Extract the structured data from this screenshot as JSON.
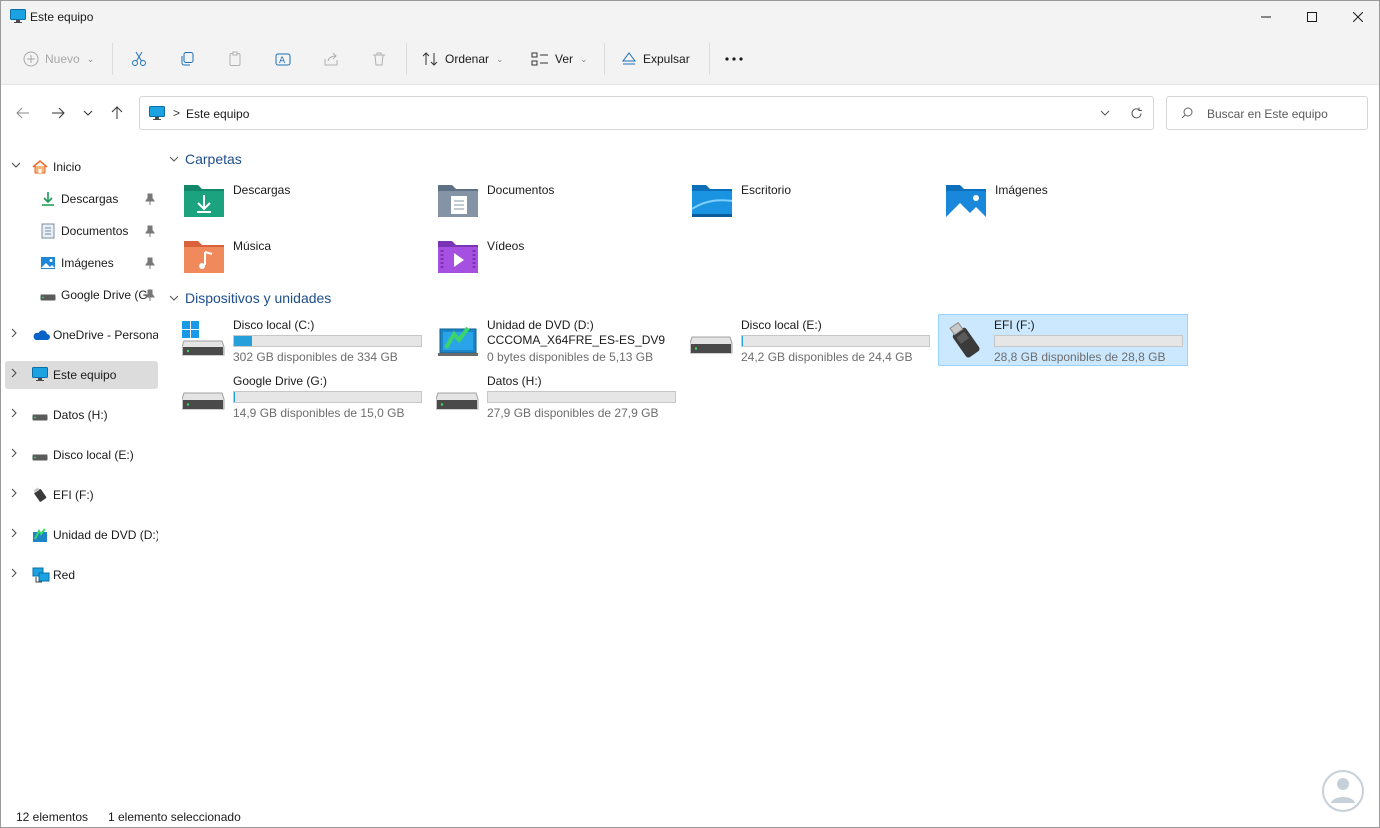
{
  "window": {
    "title": "Este equipo"
  },
  "toolbar": {
    "new_label": "Nuevo",
    "sort_label": "Ordenar",
    "view_label": "Ver",
    "eject_label": "Expulsar"
  },
  "address": {
    "path": "Este equipo",
    "separator": ">"
  },
  "search": {
    "placeholder": "Buscar en Este equipo"
  },
  "sidebar": {
    "items": [
      {
        "label": "Inicio"
      },
      {
        "label": "Descargas"
      },
      {
        "label": "Documentos"
      },
      {
        "label": "Imágenes"
      },
      {
        "label": "Google Drive (G"
      },
      {
        "label": "OneDrive - Personal"
      },
      {
        "label": "Este equipo"
      },
      {
        "label": "Datos (H:)"
      },
      {
        "label": "Disco local (E:)"
      },
      {
        "label": "EFI (F:)"
      },
      {
        "label": "Unidad de DVD (D:)"
      },
      {
        "label": "Red"
      }
    ]
  },
  "sections": {
    "folders": "Carpetas",
    "devices": "Dispositivos y unidades"
  },
  "folders": [
    {
      "name": "Descargas"
    },
    {
      "name": "Documentos"
    },
    {
      "name": "Escritorio"
    },
    {
      "name": "Imágenes"
    },
    {
      "name": "Música"
    },
    {
      "name": "Vídeos"
    }
  ],
  "drives": [
    {
      "name": "Disco local (C:)",
      "free_text": "302 GB disponibles de 334 GB",
      "used_fraction": 0.096
    },
    {
      "name": "Unidad de DVD (D:)",
      "name2": "CCCOMA_X64FRE_ES-ES_DV9",
      "free_text": "0 bytes disponibles de 5,13 GB"
    },
    {
      "name": "Disco local (E:)",
      "free_text": "24,2 GB disponibles de 24,4 GB",
      "used_fraction": 0.008
    },
    {
      "name": "EFI (F:)",
      "free_text": "28,8 GB disponibles de 28,8 GB",
      "used_fraction": 0.0
    },
    {
      "name": "Google Drive (G:)",
      "free_text": "14,9 GB disponibles de 15,0 GB",
      "used_fraction": 0.007
    },
    {
      "name": "Datos (H:)",
      "free_text": "27,9 GB disponibles de 27,9 GB",
      "used_fraction": 0.0
    }
  ],
  "status": {
    "count": "12 elementos",
    "selection": "1 elemento seleccionado"
  },
  "colors": {
    "accent": "#26a0da",
    "selected_bg": "#cce8ff",
    "section_title": "#1e4e8c"
  }
}
